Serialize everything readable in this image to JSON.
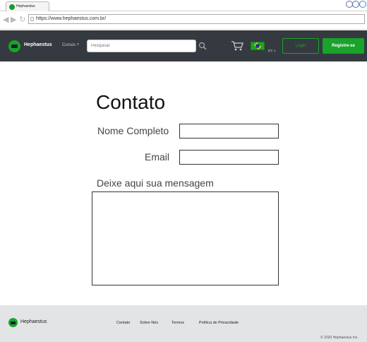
{
  "browser": {
    "tab_title": "Hephaestus",
    "url": "https://www.hephaestus.com.br/"
  },
  "header": {
    "brand": "Hephaestus",
    "courses": "Cursos",
    "search_placeholder": "Pesquisar",
    "language": "PT",
    "login": "Login",
    "register": "Registre-se",
    "accent_color": "#1aa32a",
    "background_color": "#353a40"
  },
  "form": {
    "title": "Contato",
    "name_label": "Nome Completo",
    "email_label": "Email",
    "message_label": "Deixe aqui sua mensagem"
  },
  "footer": {
    "brand": "Hephaestus",
    "links": [
      "Contato",
      "Sobre Nós",
      "Termos",
      "Política de Privacidade"
    ],
    "copyright": "© 2020 Hephaestus Inc."
  }
}
